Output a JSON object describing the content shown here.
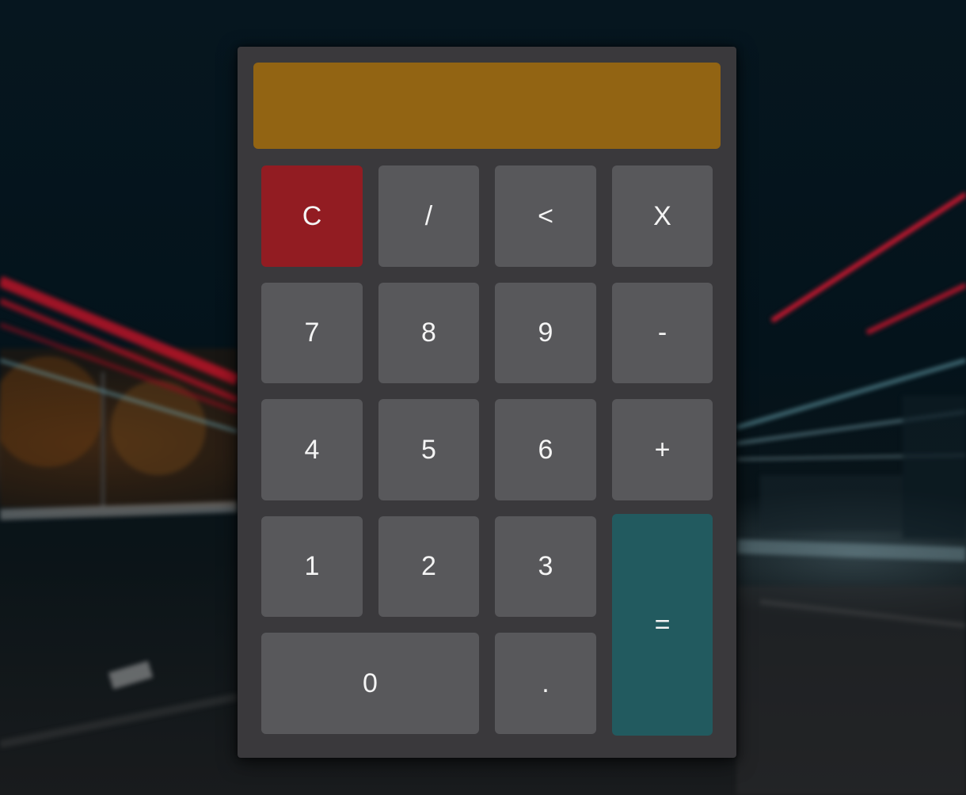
{
  "display": {
    "value": ""
  },
  "keys": {
    "clear": "C",
    "divide": "/",
    "backspace": "<",
    "multiply": "X",
    "seven": "7",
    "eight": "8",
    "nine": "9",
    "minus": "-",
    "four": "4",
    "five": "5",
    "six": "6",
    "plus": "+",
    "one": "1",
    "two": "2",
    "three": "3",
    "equals": "=",
    "zero": "0",
    "decimal": "."
  },
  "colors": {
    "display": "#926413",
    "clear_key": "#921c22",
    "equals_key": "#225a5f",
    "key": "#58585b",
    "body": "#3a393c"
  }
}
